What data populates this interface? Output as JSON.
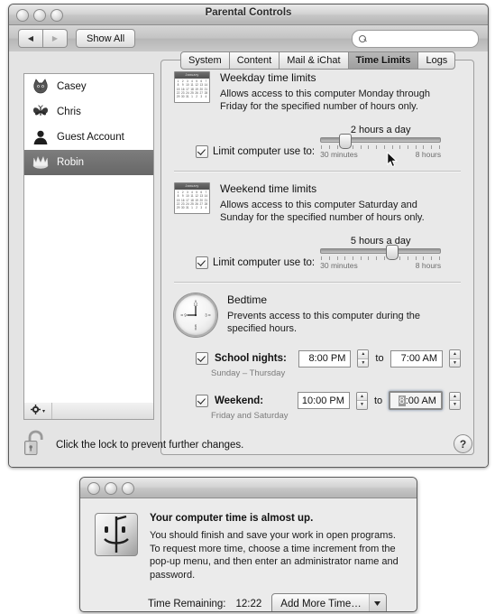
{
  "window": {
    "title": "Parental Controls",
    "traffic_lights": [
      "close",
      "minimize",
      "zoom"
    ],
    "toolbar": {
      "back_label": "◀",
      "forward_label": "▶",
      "show_all_label": "Show All",
      "search_placeholder": "",
      "search_value": "",
      "search_icon": "search-icon"
    }
  },
  "sidebar": {
    "users": [
      {
        "name": "Casey",
        "icon": "cat-icon",
        "selected": false
      },
      {
        "name": "Chris",
        "icon": "butterfly-icon",
        "selected": false
      },
      {
        "name": "Guest Account",
        "icon": "person-icon",
        "selected": false
      },
      {
        "name": "Robin",
        "icon": "crown-icon",
        "selected": true
      }
    ],
    "gear_icon": "gear-icon",
    "gear_disclosure": "▾"
  },
  "tabs": [
    {
      "label": "System",
      "active": false
    },
    {
      "label": "Content",
      "active": false
    },
    {
      "label": "Mail & iChat",
      "active": false
    },
    {
      "label": "Time Limits",
      "active": true
    },
    {
      "label": "Logs",
      "active": false
    }
  ],
  "weekday": {
    "icon": "calendar-icon",
    "calendar_month": "January",
    "title": "Weekday time limits",
    "description": "Allows access to this computer Monday through Friday for the specified number of hours only.",
    "checkbox_label": "Limit computer use to:",
    "checked": true,
    "slider_value_label": "2 hours a day",
    "slider_min_label": "30 minutes",
    "slider_max_label": "8 hours",
    "slider_percent": 20
  },
  "weekend": {
    "icon": "calendar-icon",
    "calendar_month": "January",
    "title": "Weekend time limits",
    "description": "Allows access to this computer Saturday and Sunday for the specified number of hours only.",
    "checkbox_label": "Limit computer use to:",
    "checked": true,
    "slider_value_label": "5 hours a day",
    "slider_min_label": "30 minutes",
    "slider_max_label": "8 hours",
    "slider_percent": 60
  },
  "bedtime": {
    "icon": "clock-icon",
    "title": "Bedtime",
    "description": "Prevents access to this computer during the specified hours.",
    "to_word": "to",
    "school": {
      "label": "School nights:",
      "checked": true,
      "sublabel": "Sunday – Thursday",
      "start_time": "8:00 PM",
      "end_time": "7:00 AM"
    },
    "weekend": {
      "label": "Weekend:",
      "checked": true,
      "sublabel": "Friday and Saturday",
      "start_time": "10:00 PM",
      "end_time_selected": "8",
      "end_time_rest": ":00 AM",
      "end_focused": true
    },
    "stepper_up": "▲",
    "stepper_down": "▼"
  },
  "lockbar": {
    "icon": "unlocked-padlock-icon",
    "text": "Click the lock to prevent further changes.",
    "help_label": "?"
  },
  "dialog": {
    "traffic_lights": [
      "close",
      "minimize",
      "zoom"
    ],
    "icon": "finder-face-icon",
    "title": "Your computer time is almost up.",
    "body": "You should finish and save your work in open programs. To request more time, choose a time increment from the pop-up menu, and then enter an administrator name and password.",
    "time_remaining_label": "Time Remaining:",
    "time_remaining_value": "12:22",
    "popup_label": "Add More Time…",
    "popup_arrow": "▼"
  },
  "calendar_days": [
    "1",
    "2",
    "3",
    "4",
    "5",
    "6",
    "7",
    "8",
    "9",
    "10",
    "11",
    "12",
    "13",
    "14",
    "15",
    "16",
    "17",
    "18",
    "19",
    "20",
    "21",
    "22",
    "23",
    "24",
    "25",
    "26",
    "27",
    "28",
    "29",
    "30",
    "31",
    "1",
    "2",
    "3",
    "4"
  ],
  "colors": {
    "selection": "#707070",
    "window_bg": "#e4e4e4",
    "panel_bg": "#e9e9e9"
  }
}
